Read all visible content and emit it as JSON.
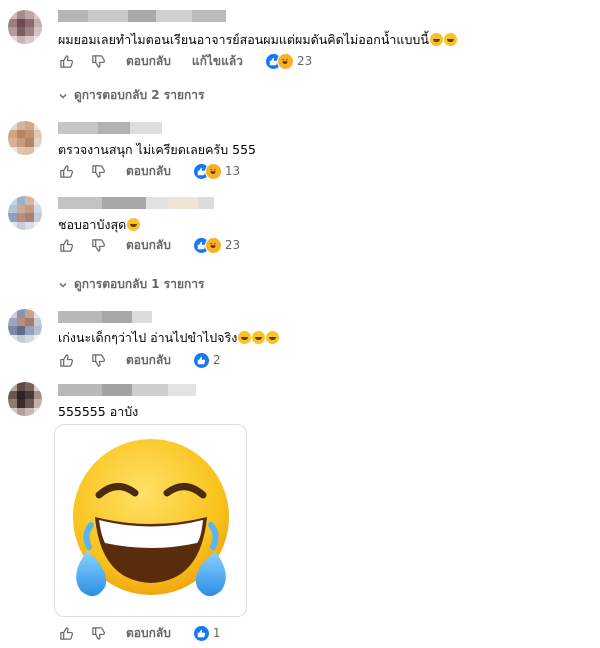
{
  "labels": {
    "reply": "ตอบกลับ",
    "edited": "แก้ไขแล้ว"
  },
  "icons": {
    "like": "thumbs-up-icon",
    "dislike": "thumbs-down-icon",
    "reaction_like": "like-reaction-icon",
    "reaction_haha": "haha-reaction-icon",
    "chevron": "chevron-down-icon"
  },
  "colors": {
    "like_blue": "#1877f2",
    "haha_yellow": "#f7b125",
    "muted_text": "#65676b"
  },
  "comments": [
    {
      "text": "ผมยอมเลยทำไมตอนเรียนอาจารย์สอนผมแต่ผมดันคิดไม่ออกน้ำแบบนี้",
      "reactions": "23"
    },
    {
      "text": "ตรวจงานสนุก ไม่เครียดเลยครับ 555",
      "reactions": "13"
    },
    {
      "text": "ชอบอาบังสุด",
      "reactions": "23"
    },
    {
      "text": "เก่งนะเด็กๆว่าไป อ่านไปขำไปจริง",
      "reactions": "2"
    },
    {
      "text": "555555 อาบัง",
      "reactions": "1"
    }
  ],
  "view_replies": [
    {
      "label": "ดูการตอบกลับ 2 รายการ"
    },
    {
      "label": "ดูการตอบกลับ 1 รายการ"
    }
  ],
  "sticker": {
    "name": "tears-of-joy-emoji"
  }
}
